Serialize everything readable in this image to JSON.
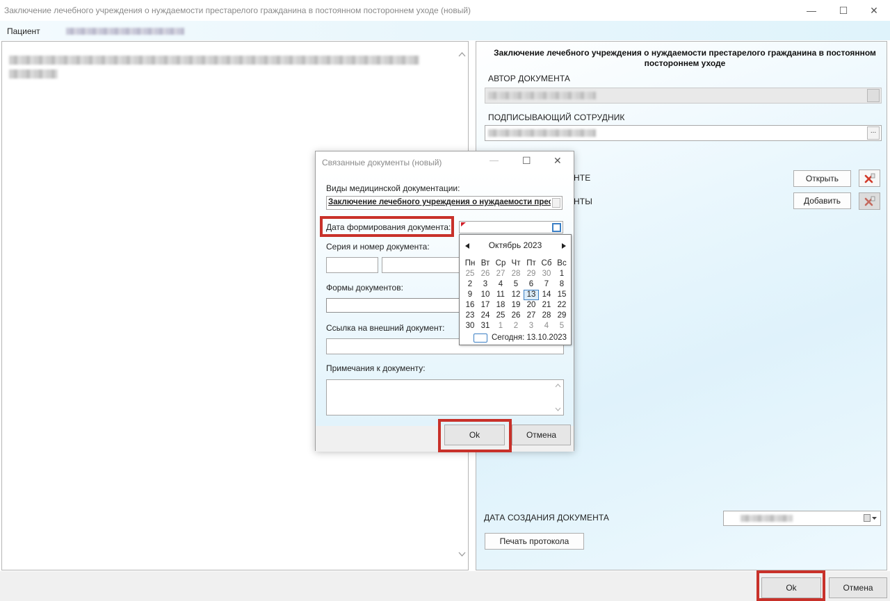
{
  "window": {
    "title": "Заключение лечебного учреждения о нуждаемости престарелого гражданина в постоянном постороннем уходе (новый)",
    "minimize_glyph": "—",
    "maximize_glyph": "☐",
    "close_glyph": "✕"
  },
  "patient_bar": {
    "label": "Пациент"
  },
  "right_panel": {
    "title": "Заключение лечебного учреждения о нуждаемости престарелого гражданина в постоянном постороннем уходе",
    "author_label": "АВТОР ДОКУМЕНТА",
    "signer_label": "ПОДПИСЫВАЮЩИЙ СОТРУДНИК",
    "dots": "...",
    "related_row1_label_tail": "НТЕ",
    "related_row2_label_tail": "НТЫ",
    "open_button": "Открыть",
    "add_button": "Добавить",
    "creation_date_label": "ДАТА СОЗДАНИЯ ДОКУМЕНТА",
    "print_button": "Печать протокола"
  },
  "bottom": {
    "ok": "Ok",
    "cancel": "Отмена"
  },
  "dialog": {
    "title": "Связанные документы (новый)",
    "doc_type_label": "Виды медицинской документации:",
    "doc_type_value": "Заключение лечебного учреждения о нуждаемости престарелого гражданина в постоянном постороннем уходе",
    "date_label": "Дата формирования документа:",
    "series_label": "Серия и номер документа:",
    "forms_label": "Формы документов:",
    "link_label": "Ссылка на внешний документ:",
    "notes_label": "Примечания к документу:",
    "ok": "Ok",
    "cancel": "Отмена"
  },
  "calendar": {
    "month": "Октябрь 2023",
    "weekdays": [
      "Пн",
      "Вт",
      "Ср",
      "Чт",
      "Пт",
      "Сб",
      "Вс"
    ],
    "days": [
      [
        "25",
        "26",
        "27",
        "28",
        "29",
        "30",
        "1"
      ],
      [
        "2",
        "3",
        "4",
        "5",
        "6",
        "7",
        "8"
      ],
      [
        "9",
        "10",
        "11",
        "12",
        "13",
        "14",
        "15"
      ],
      [
        "16",
        "17",
        "18",
        "19",
        "20",
        "21",
        "22"
      ],
      [
        "23",
        "24",
        "25",
        "26",
        "27",
        "28",
        "29"
      ],
      [
        "30",
        "31",
        "1",
        "2",
        "3",
        "4",
        "5"
      ]
    ],
    "selected": "13",
    "today_text": "Сегодня: 13.10.2023"
  },
  "colors": {
    "highlight_red": "#c8312a",
    "accent_blue": "#3b7fc4"
  }
}
